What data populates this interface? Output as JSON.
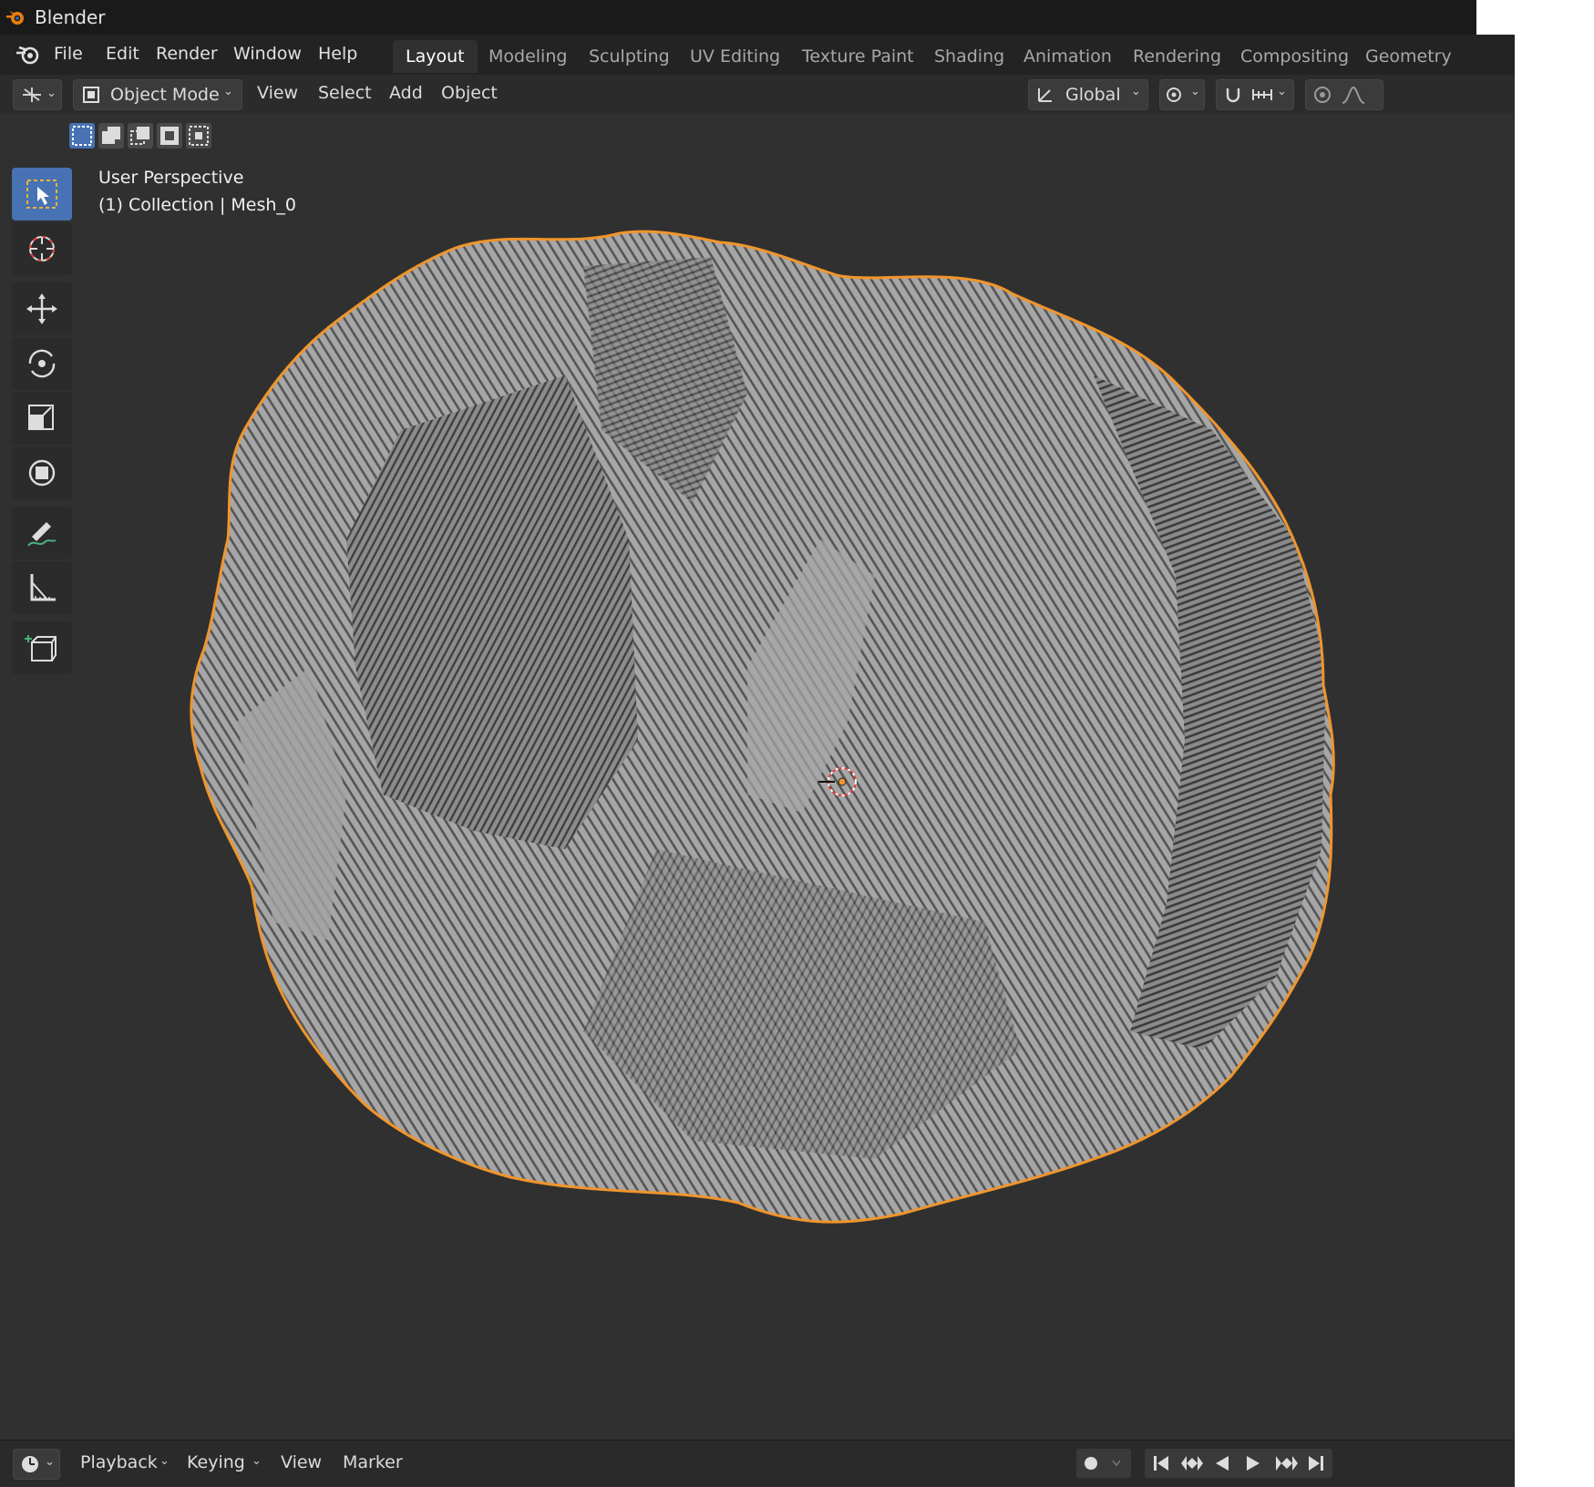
{
  "window": {
    "title": "Blender"
  },
  "menu": {
    "file": "File",
    "edit": "Edit",
    "render": "Render",
    "window": "Window",
    "help": "Help"
  },
  "workspaces": [
    "Layout",
    "Modeling",
    "Sculpting",
    "UV Editing",
    "Texture Paint",
    "Shading",
    "Animation",
    "Rendering",
    "Compositing",
    "Geometry Notry No"
  ],
  "active_workspace": "Layout",
  "header": {
    "mode": "Object Mode",
    "view": "View",
    "select": "Select",
    "add": "Add",
    "object": "Object",
    "orientation": "Global"
  },
  "viewport": {
    "perspective": "User Perspective",
    "collection_info": "(1) Collection | Mesh_0",
    "selection_outline_color": "#f0952c",
    "mesh_color": "#a3a3a3"
  },
  "toolbar": {
    "tools": [
      "select-box-icon",
      "cursor-icon",
      "move-icon",
      "rotate-icon",
      "scale-icon",
      "transform-icon",
      "annotate-icon",
      "measure-icon",
      "add-cube-icon"
    ],
    "active": "select-box-icon"
  },
  "timeline": {
    "playback": "Playback",
    "keying": "Keying",
    "view": "View",
    "marker": "Marker"
  },
  "colors": {
    "accent": "#4772b3",
    "background": "#303030",
    "selection": "#f0952c"
  }
}
